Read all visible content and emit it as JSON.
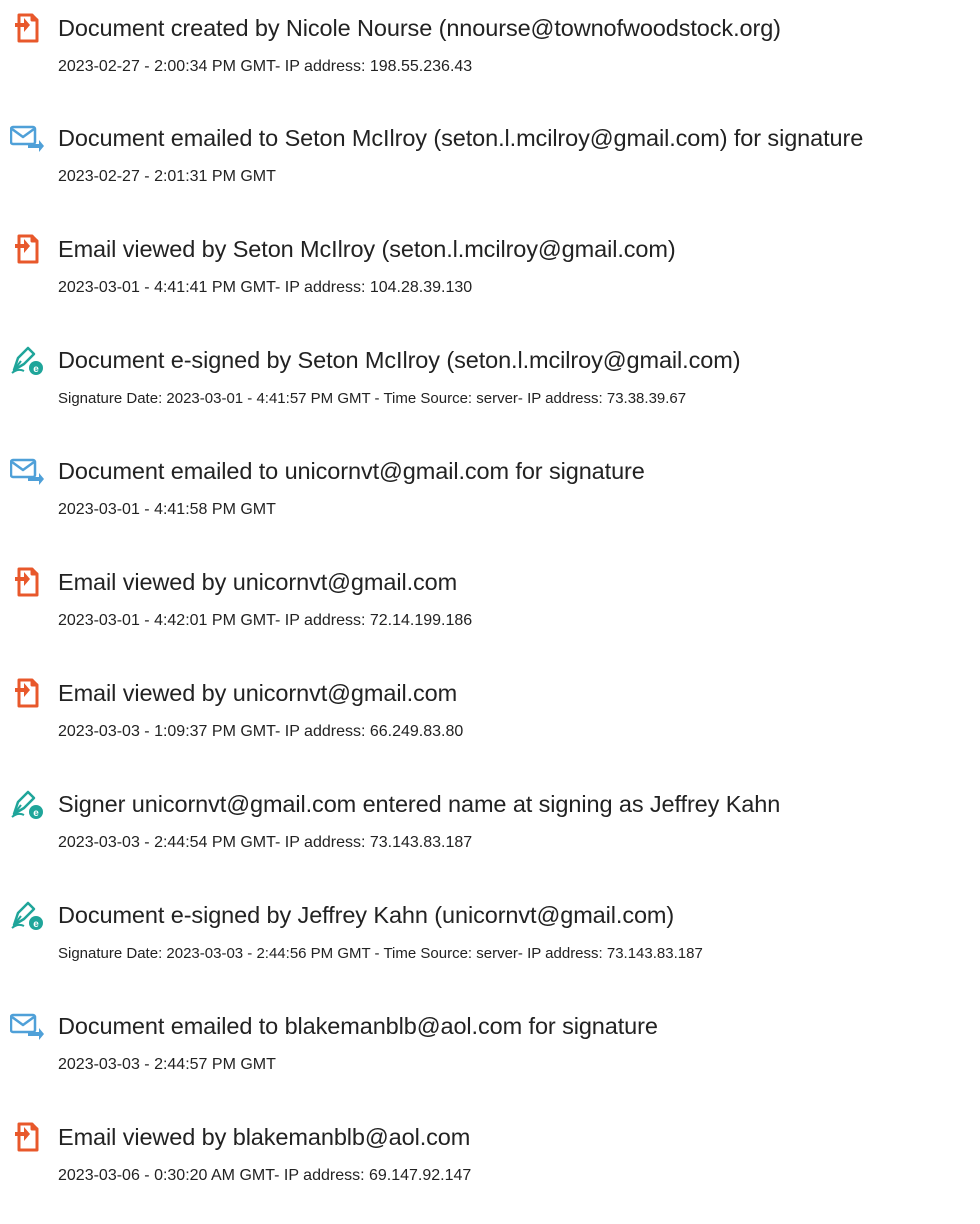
{
  "colors": {
    "doc_icon": "#E8582B",
    "mail_icon": "#4FA0D8",
    "esign_icon": "#1FA59A"
  },
  "entries": [
    {
      "icon": "document-icon",
      "title": "Document created by Nicole Nourse (nnourse@townofwoodstock.org)",
      "detail": "2023-02-27 - 2:00:34 PM GMT- IP address: 198.55.236.43"
    },
    {
      "icon": "email-icon",
      "title": "Document emailed to Seton McIlroy (seton.l.mcilroy@gmail.com) for signature",
      "detail": "2023-02-27 - 2:01:31 PM GMT"
    },
    {
      "icon": "document-icon",
      "title": "Email viewed by Seton McIlroy (seton.l.mcilroy@gmail.com)",
      "detail": "2023-03-01 - 4:41:41 PM GMT- IP address: 104.28.39.130"
    },
    {
      "icon": "esign-icon",
      "title": "Document e-signed by Seton McIlroy (seton.l.mcilroy@gmail.com)",
      "detail": "Signature Date: 2023-03-01 - 4:41:57 PM GMT - Time Source: server- IP address: 73.38.39.67"
    },
    {
      "icon": "email-icon",
      "title": "Document emailed to unicornvt@gmail.com for signature",
      "detail": "2023-03-01 - 4:41:58 PM GMT"
    },
    {
      "icon": "document-icon",
      "title": "Email viewed by unicornvt@gmail.com",
      "detail": "2023-03-01 - 4:42:01 PM GMT- IP address: 72.14.199.186"
    },
    {
      "icon": "document-icon",
      "title": "Email viewed by unicornvt@gmail.com",
      "detail": "2023-03-03 - 1:09:37 PM GMT- IP address: 66.249.83.80"
    },
    {
      "icon": "esign-icon",
      "title": "Signer unicornvt@gmail.com entered name at signing as Jeffrey Kahn",
      "detail": "2023-03-03 - 2:44:54 PM GMT- IP address: 73.143.83.187"
    },
    {
      "icon": "esign-icon",
      "title": "Document e-signed by Jeffrey Kahn (unicornvt@gmail.com)",
      "detail": "Signature Date: 2023-03-03 - 2:44:56 PM GMT - Time Source: server- IP address: 73.143.83.187"
    },
    {
      "icon": "email-icon",
      "title": "Document emailed to blakemanblb@aol.com for signature",
      "detail": "2023-03-03 - 2:44:57 PM GMT"
    },
    {
      "icon": "document-icon",
      "title": "Email viewed by blakemanblb@aol.com",
      "detail": "2023-03-06 - 0:30:20 AM GMT- IP address: 69.147.92.147"
    }
  ]
}
